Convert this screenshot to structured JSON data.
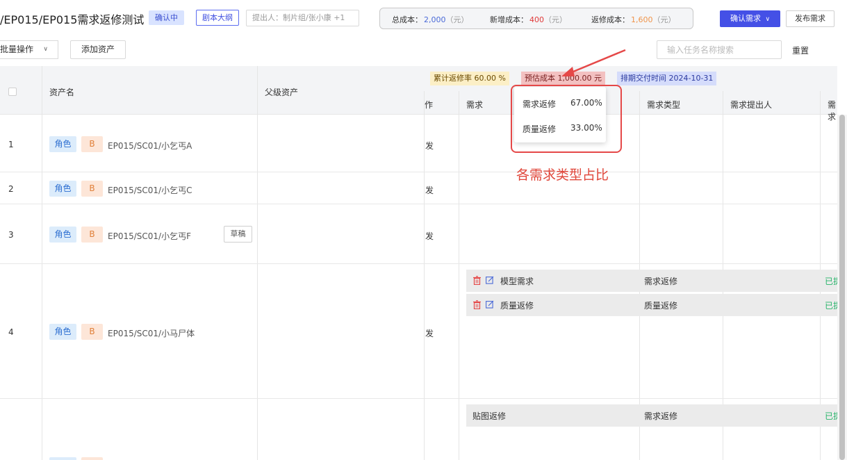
{
  "header": {
    "title": "/EP015/EP015需求返修测试",
    "status_tag": "确认中",
    "script_outline_button": "剧本大纲",
    "proposer": "提出人：制片组/张小康 +1",
    "costs": {
      "total_label": "总成本：",
      "total_value": "2,000",
      "total_unit": "（元）",
      "new_label": "新增成本：",
      "new_value": "400",
      "new_unit": "（元）",
      "repair_label": "返修成本：",
      "repair_value": "1,600",
      "repair_unit": "（元）"
    },
    "confirm_button": "确认需求",
    "publish_button": "发布需求"
  },
  "toolbar": {
    "bulk_ops": "批量操作",
    "add_asset": "添加资产",
    "search_placeholder": "输入任务名称搜索",
    "reset": "重置"
  },
  "table": {
    "columns": {
      "asset_name": "资产名",
      "parent_asset": "父级资产",
      "operation": "作",
      "requirement": "需求",
      "req_type": "需求类型",
      "req_proposer": "需求提出人",
      "req_more": "需求"
    },
    "stats": {
      "repair_rate": "累计返修率 60.00 %",
      "est_cost": "预估成本 1,000.00 元",
      "delivery": "排期交付时间 2024-10-31"
    },
    "rows": [
      {
        "no": "1",
        "role": "角色",
        "grade": "B",
        "path": "EP015/SC01/小乞丐A",
        "op": "发"
      },
      {
        "no": "2",
        "role": "角色",
        "grade": "B",
        "path": "EP015/SC01/小乞丐C",
        "op": "发"
      },
      {
        "no": "3",
        "role": "角色",
        "grade": "B",
        "path": "EP015/SC01/小乞丐F",
        "op": "发",
        "draft": "草稿"
      },
      {
        "no": "4",
        "role": "角色",
        "grade": "B",
        "path": "EP015/SC01/小马尸体",
        "op": "发"
      }
    ],
    "requirements": [
      {
        "name": "模型需求",
        "type": "需求返修",
        "status": "已提"
      },
      {
        "name": "质量返修",
        "type": "质量返修",
        "status": "已提"
      },
      {
        "name": "贴图返修",
        "type": "需求返修",
        "status": "已提"
      }
    ]
  },
  "popover": {
    "items": [
      {
        "label": "需求返修",
        "pct": "67.00%"
      },
      {
        "label": "质量返修",
        "pct": "33.00%"
      }
    ]
  },
  "annotation": {
    "text": "各需求类型占比"
  },
  "colors": {
    "primary": "#4450e6",
    "annotation_red": "#e54848",
    "status_green": "#27b46a"
  }
}
